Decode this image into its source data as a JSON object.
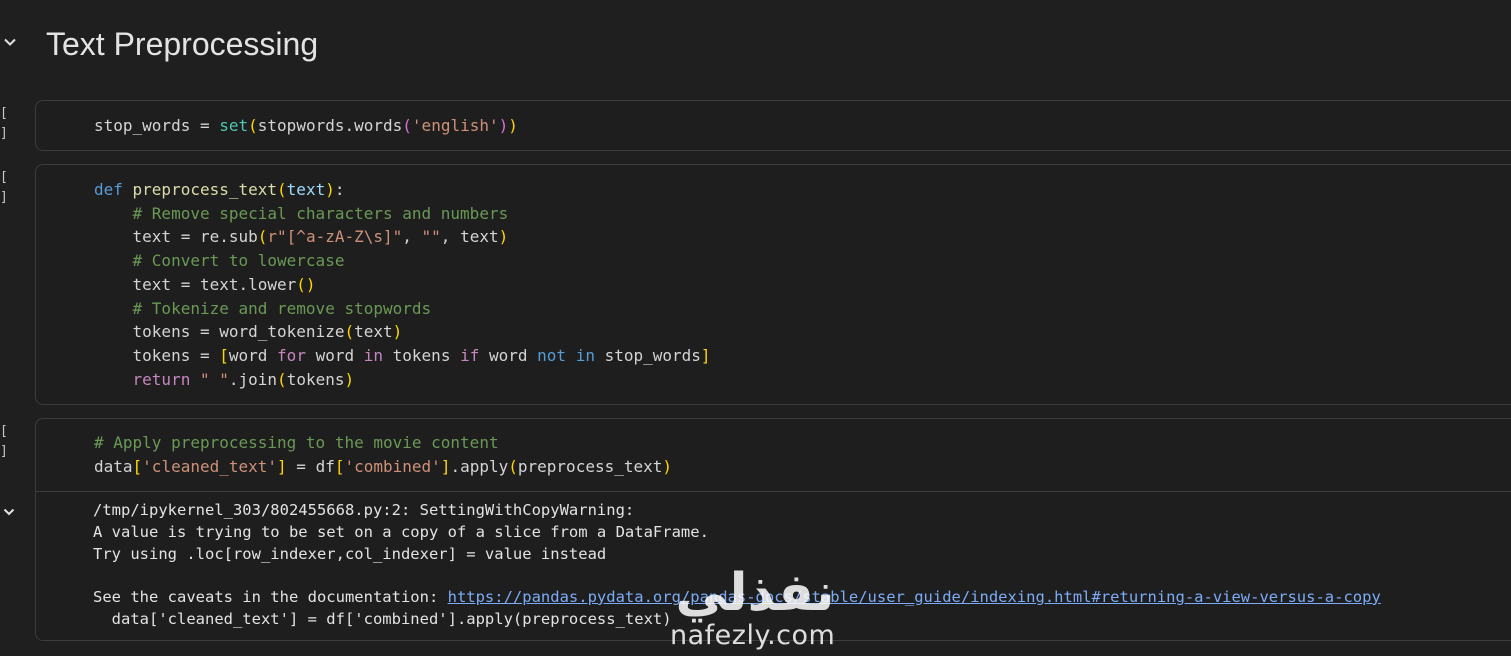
{
  "section": {
    "title": "Text Preprocessing"
  },
  "cells": [
    {
      "run_label": "[ ]",
      "lines": [
        [
          {
            "t": "stop_words = ",
            "c": ""
          },
          {
            "t": "set",
            "c": "bi"
          },
          {
            "t": "(",
            "c": "paren1"
          },
          {
            "t": "stopwords.words",
            "c": ""
          },
          {
            "t": "(",
            "c": "paren2"
          },
          {
            "t": "'english'",
            "c": "str"
          },
          {
            "t": ")",
            "c": "paren2"
          },
          {
            "t": ")",
            "c": "paren1"
          }
        ]
      ]
    },
    {
      "run_label": "[ ]",
      "lines": [
        [
          {
            "t": "def ",
            "c": "kw"
          },
          {
            "t": "preprocess_text",
            "c": "fn"
          },
          {
            "t": "(",
            "c": "paren1"
          },
          {
            "t": "text",
            "c": "param"
          },
          {
            "t": ")",
            "c": "paren1"
          },
          {
            "t": ":",
            "c": ""
          }
        ],
        [
          {
            "t": "    # Remove special characters and numbers",
            "c": "cmt"
          }
        ],
        [
          {
            "t": "    text = re.sub",
            "c": ""
          },
          {
            "t": "(",
            "c": "paren1"
          },
          {
            "t": "r\"[^a-zA-Z\\s]\"",
            "c": "str"
          },
          {
            "t": ", ",
            "c": ""
          },
          {
            "t": "\"\"",
            "c": "str"
          },
          {
            "t": ", text",
            "c": ""
          },
          {
            "t": ")",
            "c": "paren1"
          }
        ],
        [
          {
            "t": "    # Convert to lowercase",
            "c": "cmt"
          }
        ],
        [
          {
            "t": "    text = text.lower",
            "c": ""
          },
          {
            "t": "()",
            "c": "paren1"
          }
        ],
        [
          {
            "t": "    # Tokenize and remove stopwords",
            "c": "cmt"
          }
        ],
        [
          {
            "t": "    tokens = word_tokenize",
            "c": ""
          },
          {
            "t": "(",
            "c": "paren1"
          },
          {
            "t": "text",
            "c": ""
          },
          {
            "t": ")",
            "c": "paren1"
          }
        ],
        [
          {
            "t": "    tokens = ",
            "c": ""
          },
          {
            "t": "[",
            "c": "paren1"
          },
          {
            "t": "word ",
            "c": ""
          },
          {
            "t": "for",
            "c": "ctrl"
          },
          {
            "t": " word ",
            "c": ""
          },
          {
            "t": "in",
            "c": "ctrl"
          },
          {
            "t": " tokens ",
            "c": ""
          },
          {
            "t": "if",
            "c": "ctrl"
          },
          {
            "t": " word ",
            "c": ""
          },
          {
            "t": "not",
            "c": "kw"
          },
          {
            "t": " ",
            "c": ""
          },
          {
            "t": "in",
            "c": "kw"
          },
          {
            "t": " stop_words",
            "c": ""
          },
          {
            "t": "]",
            "c": "paren1"
          }
        ],
        [
          {
            "t": "    ",
            "c": ""
          },
          {
            "t": "return",
            "c": "ctrl"
          },
          {
            "t": " ",
            "c": ""
          },
          {
            "t": "\" \"",
            "c": "str"
          },
          {
            "t": ".join",
            "c": ""
          },
          {
            "t": "(",
            "c": "paren1"
          },
          {
            "t": "tokens",
            "c": ""
          },
          {
            "t": ")",
            "c": "paren1"
          }
        ]
      ]
    },
    {
      "run_label": "[ ]",
      "lines": [
        [
          {
            "t": "# Apply preprocessing to the movie content",
            "c": "cmt"
          }
        ],
        [
          {
            "t": "data",
            "c": ""
          },
          {
            "t": "[",
            "c": "paren1"
          },
          {
            "t": "'cleaned_text'",
            "c": "str"
          },
          {
            "t": "]",
            "c": "paren1"
          },
          {
            "t": " = df",
            "c": ""
          },
          {
            "t": "[",
            "c": "paren1"
          },
          {
            "t": "'combined'",
            "c": "str"
          },
          {
            "t": "]",
            "c": "paren1"
          },
          {
            "t": ".apply",
            "c": ""
          },
          {
            "t": "(",
            "c": "paren1"
          },
          {
            "t": "preprocess_text",
            "c": ""
          },
          {
            "t": ")",
            "c": "paren1"
          }
        ]
      ],
      "output": {
        "line1": "/tmp/ipykernel_303/802455668.py:2: SettingWithCopyWarning:",
        "line2": "A value is trying to be set on a copy of a slice from a DataFrame.",
        "line3": "Try using .loc[row_indexer,col_indexer] = value instead",
        "line4_prefix": "See the caveats in the documentation: ",
        "line4_link": "https://pandas.pydata.org/pandas-docs/stable/user_guide/indexing.html#returning-a-view-versus-a-copy",
        "line5": "  data['cleaned_text'] = df['combined'].apply(preprocess_text)"
      }
    }
  ],
  "watermark": {
    "arabic": "نفذلي",
    "latin": "nafezly.com"
  },
  "colors": {
    "background": "#1f1f1f",
    "cell_border": "#3c3c3c",
    "keyword": "#569cd6",
    "control": "#c586c0",
    "function": "#dcdcaa",
    "builtin": "#4ec9b0",
    "string": "#ce9178",
    "comment": "#6a9955",
    "bracket": "#ffd700",
    "link": "#7cacf8"
  }
}
